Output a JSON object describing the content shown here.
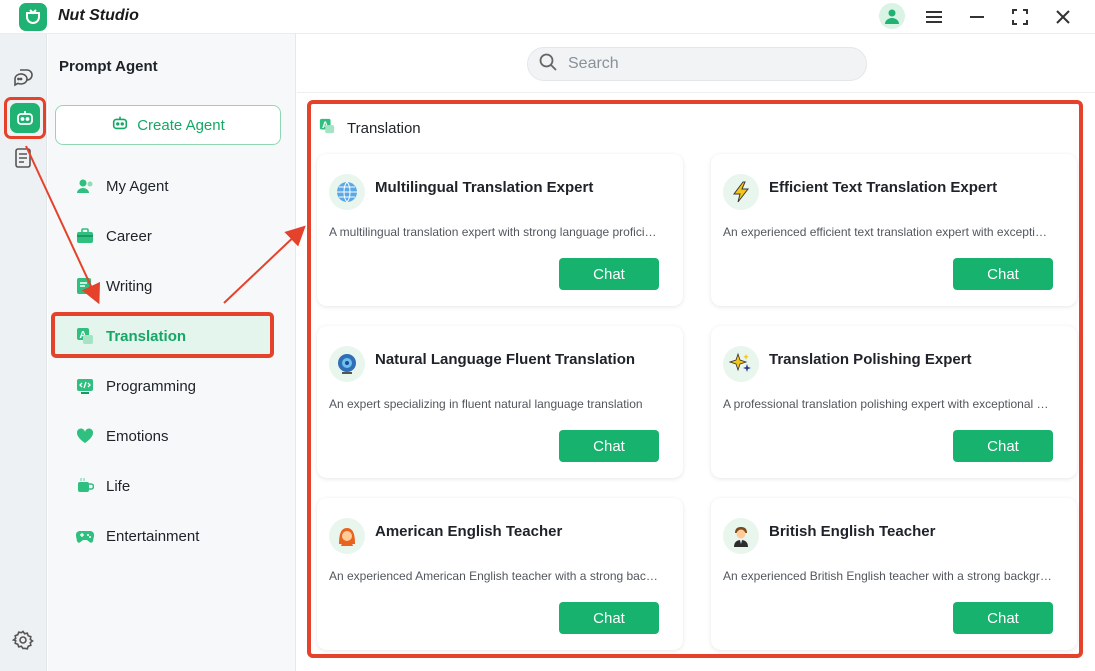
{
  "app": {
    "title": "Nut Studio"
  },
  "sidebar": {
    "title": "Prompt Agent",
    "create_label": "Create Agent",
    "categories": [
      {
        "label": "My Agent",
        "icon": "person-icon"
      },
      {
        "label": "Career",
        "icon": "briefcase-icon"
      },
      {
        "label": "Writing",
        "icon": "pen-icon"
      },
      {
        "label": "Translation",
        "icon": "translate-icon"
      },
      {
        "label": "Programming",
        "icon": "code-icon"
      },
      {
        "label": "Emotions",
        "icon": "heart-icon"
      },
      {
        "label": "Life",
        "icon": "cup-icon"
      },
      {
        "label": "Entertainment",
        "icon": "gamepad-icon"
      }
    ],
    "selected": "Translation"
  },
  "search": {
    "placeholder": "Search"
  },
  "section": {
    "title": "Translation"
  },
  "agents": [
    {
      "title": "Multilingual Translation Expert",
      "desc": "A multilingual translation expert with strong language proficiency",
      "icon": "globe-icon",
      "button": "Chat"
    },
    {
      "title": "Efficient Text Translation Expert",
      "desc": "An experienced efficient text translation expert with exceptional speed",
      "icon": "lightning-icon",
      "button": "Chat"
    },
    {
      "title": "Natural Language Fluent Translation",
      "desc": "An expert specializing in fluent natural language translation",
      "icon": "swirl-globe-icon",
      "button": "Chat"
    },
    {
      "title": "Translation Polishing Expert",
      "desc": "A professional translation polishing expert with exceptional skills",
      "icon": "sparkles-icon",
      "button": "Chat"
    },
    {
      "title": "American English Teacher",
      "desc": "An experienced American English teacher with a strong background",
      "icon": "teacher-woman-icon",
      "button": "Chat"
    },
    {
      "title": "British English Teacher",
      "desc": "An experienced British English teacher with a strong background",
      "icon": "teacher-man-icon",
      "button": "Chat"
    }
  ],
  "colors": {
    "accent": "#16b26e",
    "highlight": "#e5422c"
  }
}
